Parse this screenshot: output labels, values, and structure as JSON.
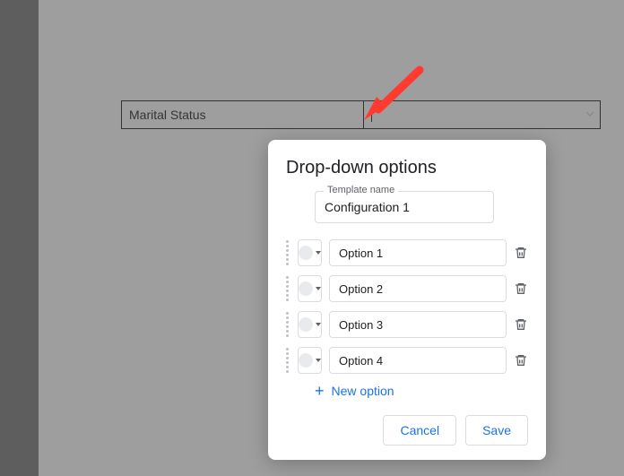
{
  "table": {
    "label_cell": "Marital Status"
  },
  "dialog": {
    "title": "Drop-down options",
    "template_label": "Template name",
    "template_value": "Configuration 1",
    "options": [
      {
        "label": "Option 1"
      },
      {
        "label": "Option 2"
      },
      {
        "label": "Option 3"
      },
      {
        "label": "Option 4"
      }
    ],
    "new_option_label": "New option",
    "cancel_label": "Cancel",
    "save_label": "Save"
  }
}
